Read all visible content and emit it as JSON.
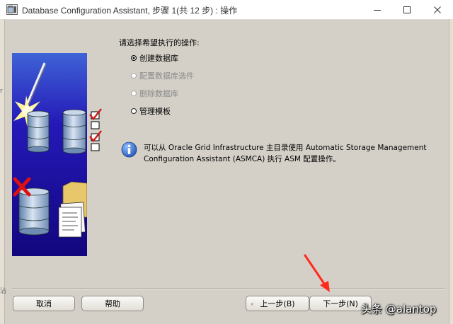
{
  "window": {
    "title": "Database Configuration Assistant, 步骤 1(共 12 步) : 操作",
    "controls": [
      "minimize-icon",
      "maximize-icon",
      "close-icon"
    ]
  },
  "edge_marks": {
    "left_upper": "r",
    "left_lower": "沾"
  },
  "prompt": "请选择希望执行的操作:",
  "options": [
    {
      "label": "创建数据库",
      "selected": true,
      "enabled": true
    },
    {
      "label": "配置数据库选件",
      "selected": false,
      "enabled": false
    },
    {
      "label": "删除数据库",
      "selected": false,
      "enabled": false
    },
    {
      "label": "管理模板",
      "selected": false,
      "enabled": true
    }
  ],
  "info": {
    "icon": "info-icon",
    "text": "可以从 Oracle Grid Infrastructure 主目录使用 Automatic Storage Management Configuration Assistant (ASMCA) 执行 ASM 配置操作。"
  },
  "buttons": {
    "cancel": "取消",
    "help": "帮助",
    "back": "上一步(B)",
    "next": "下一步(N)"
  },
  "annotation": {
    "arrow_color": "#ff2a1a"
  },
  "watermark": "头条 @alantop",
  "colors": {
    "dialog_bg": "#d4d0c8",
    "illustration_bg": "#1c0f9c",
    "info_blue": "#1f5fc6"
  }
}
